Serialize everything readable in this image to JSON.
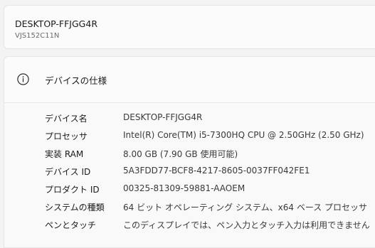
{
  "device": {
    "name": "DESKTOP-FFJGG4R",
    "model": "VJS152C11N"
  },
  "specs": {
    "title": "デバイスの仕様",
    "icon": "info-icon",
    "rows": [
      {
        "label": "デバイス名",
        "value": "DESKTOP-FFJGG4R"
      },
      {
        "label": "プロセッサ",
        "value": "Intel(R) Core(TM) i5-7300HQ CPU @ 2.50GHz (2.50 GHz)"
      },
      {
        "label": "実装 RAM",
        "value": "8.00 GB (7.90 GB 使用可能)"
      },
      {
        "label": "デバイス ID",
        "value": "5A3FDD77-BCF8-4217-8605-0037FF042FE1"
      },
      {
        "label": "プロダクト ID",
        "value": "00325-81309-59881-AAOEM"
      },
      {
        "label": "システムの種類",
        "value": "64 ビット オペレーティング システム、x64 ベース プロセッサ"
      },
      {
        "label": "ペンとタッチ",
        "value": "このディスプレイでは、ペン入力とタッチ入力は利用できません"
      }
    ]
  }
}
